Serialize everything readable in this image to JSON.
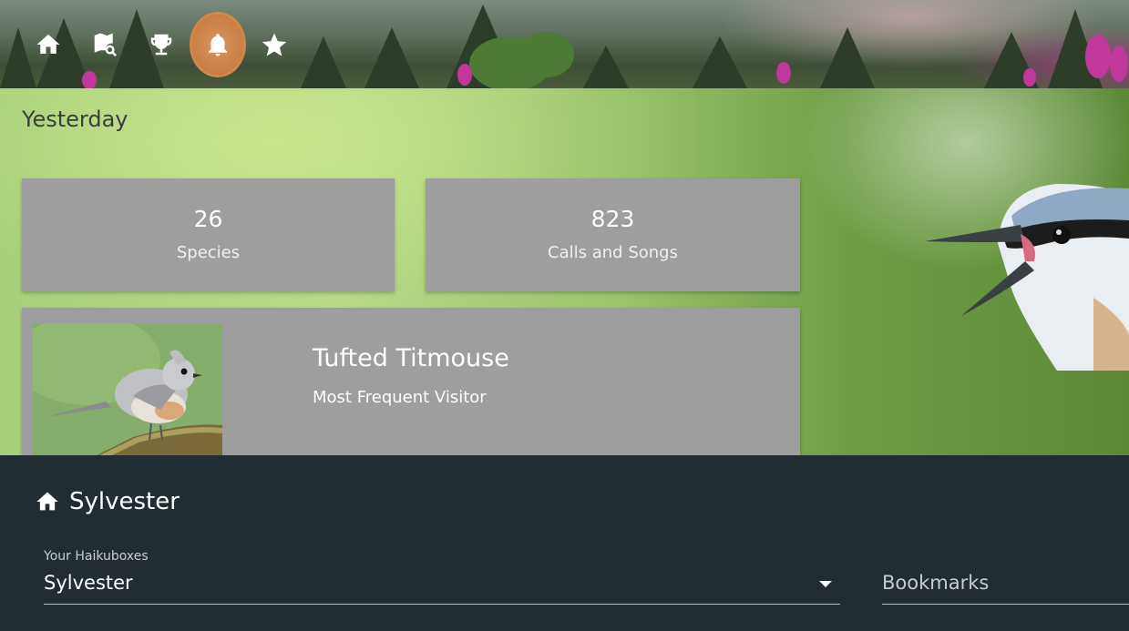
{
  "nav": {
    "items": [
      {
        "name": "home",
        "icon": "home-icon"
      },
      {
        "name": "map-search",
        "icon": "map-search-icon"
      },
      {
        "name": "trophy",
        "icon": "trophy-icon"
      },
      {
        "name": "notifications",
        "icon": "bell-icon",
        "active": true
      },
      {
        "name": "favorites",
        "icon": "star-icon"
      }
    ],
    "active_color": "#c87f45"
  },
  "summary": {
    "title": "Yesterday",
    "stats": [
      {
        "value": "26",
        "label": "Species"
      },
      {
        "value": "823",
        "label": "Calls and Songs"
      }
    ],
    "top_visitor": {
      "name": "Tufted Titmouse",
      "subtitle": "Most Frequent Visitor"
    }
  },
  "haikubox": {
    "title": "Sylvester",
    "title_icon": "home-icon",
    "select_label": "Your Haikuboxes",
    "select_value": "Sylvester",
    "bookmarks_placeholder": "Bookmarks"
  },
  "colors": {
    "card_bg": "#9e9e9e",
    "panel_bg": "#222c33"
  }
}
